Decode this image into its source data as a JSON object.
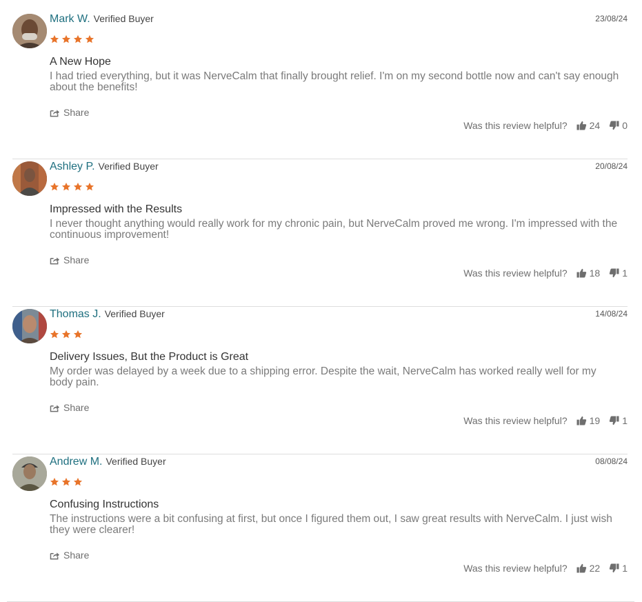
{
  "helpful_prompt": "Was this review helpful?",
  "share_label": "Share",
  "colors": {
    "name": "#1e6f7f",
    "star": "#e8742a",
    "body_text": "#7a7a7a"
  },
  "reviews": [
    {
      "name": "Mark W.",
      "badge": "Verified Buyer",
      "date": "23/08/24",
      "rating": 4,
      "title": "A New Hope",
      "body": "I had tried everything, but it was NerveCalm that finally brought relief. I'm on my second bottle now and can't say enough about the benefits!",
      "helpful_up": "24",
      "helpful_down": "0"
    },
    {
      "name": "Ashley P.",
      "badge": "Verified Buyer",
      "date": "20/08/24",
      "rating": 4,
      "title": "Impressed with the Results",
      "body": "I never thought anything would really work for my chronic pain, but NerveCalm proved me wrong. I'm impressed with the continuous improvement!",
      "helpful_up": "18",
      "helpful_down": "1"
    },
    {
      "name": "Thomas J.",
      "badge": "Verified Buyer",
      "date": "14/08/24",
      "rating": 3,
      "title": "Delivery Issues, But the Product is Great",
      "body": "My order was delayed by a week due to a shipping error. Despite the wait, NerveCalm has worked really well for my body pain.",
      "helpful_up": "19",
      "helpful_down": "1"
    },
    {
      "name": "Andrew M.",
      "badge": "Verified Buyer",
      "date": "08/08/24",
      "rating": 3,
      "title": "Confusing Instructions",
      "body": "The instructions were a bit confusing at first, but once I figured them out, I saw great results with NerveCalm. I just wish they were clearer!",
      "helpful_up": "22",
      "helpful_down": "1"
    }
  ]
}
